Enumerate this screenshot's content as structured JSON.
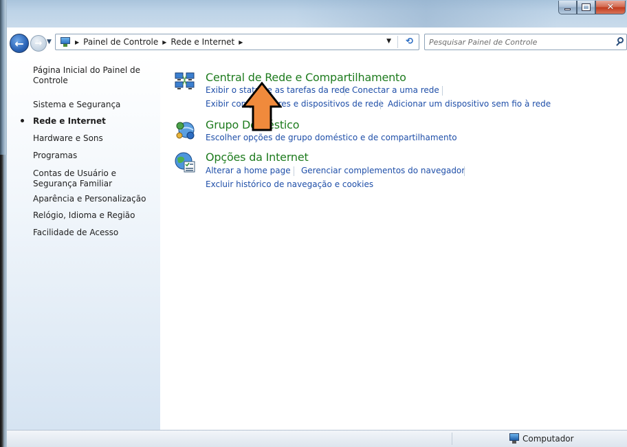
{
  "window": {
    "minimize_icon": "minimize-icon",
    "maximize_icon": "maximize-icon",
    "close_icon": "close-icon"
  },
  "navigation": {
    "back_icon": "back-arrow-icon",
    "forward_icon": "forward-arrow-icon",
    "breadcrumb": [
      "Painel de Controle",
      "Rede e Internet"
    ],
    "search_placeholder": "Pesquisar Painel de Controle"
  },
  "sidebar": {
    "items": [
      {
        "label": "Página Inicial do Painel de Controle",
        "active": false
      },
      {
        "label": "Sistema e Segurança",
        "active": false
      },
      {
        "label": "Rede e Internet",
        "active": true
      },
      {
        "label": "Hardware e Sons",
        "active": false
      },
      {
        "label": "Programas",
        "active": false
      },
      {
        "label": "Contas de Usuário e Segurança Familiar",
        "active": false
      },
      {
        "label": "Aparência e Personalização",
        "active": false
      },
      {
        "label": "Relógio, Idioma e Região",
        "active": false
      },
      {
        "label": "Facilidade de Acesso",
        "active": false
      }
    ]
  },
  "categories": [
    {
      "title": "Central de Rede e Compartilhamento",
      "icon": "network-center-icon",
      "links": [
        "Exibir o status e as tarefas da rede",
        "Conectar a uma rede",
        "Exibir computadores e dispositivos de rede",
        "Adicionar um dispositivo sem fio à rede"
      ]
    },
    {
      "title": "Grupo Doméstico",
      "icon": "homegroup-icon",
      "links": [
        "Escolher opções de grupo doméstico e de compartilhamento"
      ]
    },
    {
      "title": "Opções da Internet",
      "icon": "internet-options-icon",
      "links": [
        "Alterar a home page",
        "Gerenciar complementos do navegador",
        "Excluir histórico de navegação e cookies"
      ]
    }
  ],
  "statusbar": {
    "location": "Computador"
  },
  "colors": {
    "category_title": "#1e7b1e",
    "link": "#1e4ea8",
    "annotation_arrow": "#f08a3c"
  }
}
